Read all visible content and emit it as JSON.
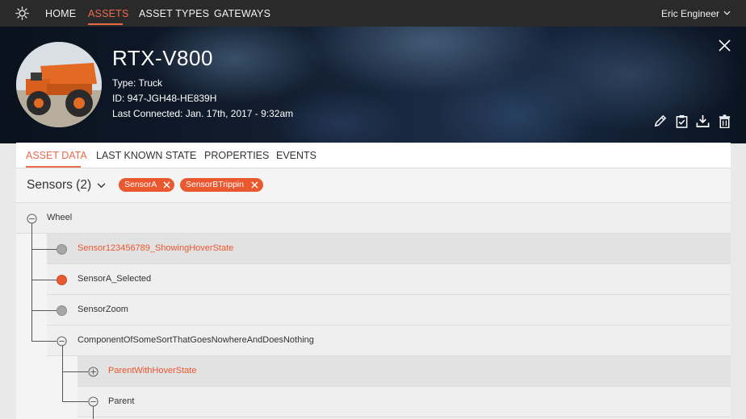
{
  "nav": {
    "items": [
      {
        "label": "HOME",
        "active": false
      },
      {
        "label": "ASSETS",
        "active": true
      },
      {
        "label": "ASSET TYPES",
        "active": false
      },
      {
        "label": "GATEWAYS",
        "active": false
      }
    ],
    "user": "Eric Engineer",
    "logo_icon": "gear-logo-icon"
  },
  "asset": {
    "title": "RTX-V800",
    "type": "Type: Truck",
    "id": "ID: 947-JGH48-HE839H",
    "last_connected": "Last Connected: Jan. 17th, 2017 - 9:32am",
    "actions": [
      "edit-icon",
      "clipboard-check-icon",
      "download-icon",
      "trash-icon"
    ]
  },
  "tabs": [
    {
      "label": "ASSET DATA",
      "active": true
    },
    {
      "label": "LAST KNOWN STATE",
      "active": false
    },
    {
      "label": "PROPERTIES",
      "active": false
    },
    {
      "label": "EVENTS",
      "active": false
    }
  ],
  "filter": {
    "title": "Sensors (2)",
    "chips": [
      "SensorA",
      "SensorBTrippin"
    ]
  },
  "tree": [
    {
      "label": "Wheel",
      "kind": "collapse",
      "highlight": false
    },
    {
      "label": "Sensor123456789_ShowingHoverState",
      "kind": "sensor",
      "highlight": true
    },
    {
      "label": "SensorA_Selected",
      "kind": "sensor-selected",
      "highlight": false
    },
    {
      "label": "SensorZoom",
      "kind": "sensor",
      "highlight": false
    },
    {
      "label": "ComponentOfSomeSortThatGoesNowhereAndDoesNothing",
      "kind": "collapse",
      "highlight": false
    },
    {
      "label": "ParentWithHoverState",
      "kind": "expand",
      "highlight": true
    },
    {
      "label": "Parent",
      "kind": "collapse",
      "highlight": false
    }
  ],
  "colors": {
    "accent": "#ec6a4c",
    "chip": "#e9582f",
    "topbar": "#2a2a2a"
  }
}
